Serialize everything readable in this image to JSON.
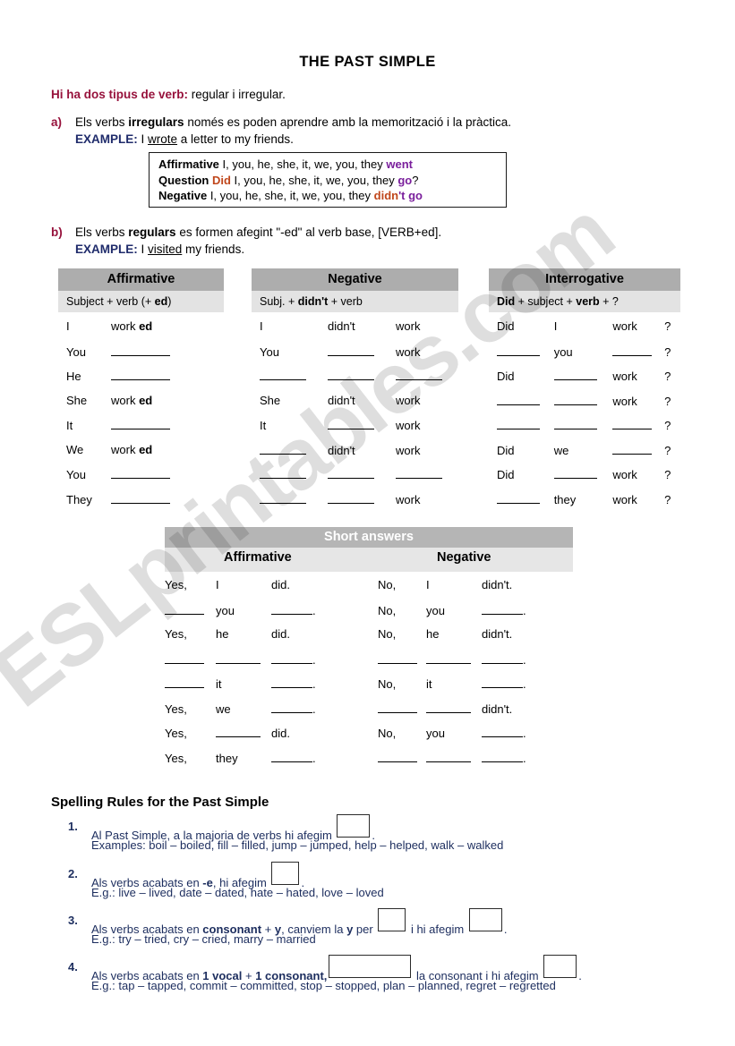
{
  "watermark": {
    "text": "ESLprintables.com"
  },
  "title": "THE PAST SIMPLE",
  "intro": {
    "lead_bold": "Hi ha dos tipus de verb:",
    "lead_rest": " regular i irregular.",
    "a_marker": "a)",
    "a_text_1": "Els verbs ",
    "a_text_bold": "irregulars",
    "a_text_2": " només es poden aprendre amb la memorització i la pràctica.",
    "a_example_label": "EXAMPLE:",
    "a_example_pre": " I ",
    "a_example_verb": "wrote",
    "a_example_post": " a letter to my friends.",
    "b_marker": "b)",
    "b_text_1": "Els verbs ",
    "b_text_bold": "regulars",
    "b_text_2": " es formen afegint \"-ed\" al verb base, [VERB+ed].",
    "b_example_label": "EXAMPLE:",
    "b_example_pre": " I ",
    "b_example_verb": "visited",
    "b_example_post": " my friends."
  },
  "irregular_box": {
    "rows": [
      {
        "label": "Affirmative",
        "pronouns": " I, you, he, she, it, we, you, they ",
        "aux": "",
        "verb": "went",
        "tail": ""
      },
      {
        "label": "Question",
        "aux": "Did",
        "pronouns": " I, you, he, she, it, we, you, they ",
        "verb": "go",
        "tail": "?"
      },
      {
        "label": "Negative",
        "pronouns": " I, you, he, she, it, we, you, they ",
        "aux": "didn",
        "verb": "'t go",
        "tail": ""
      }
    ]
  },
  "tables": {
    "affirmative": {
      "header": "Affirmative",
      "formula_parts": [
        "Subject + verb (+ ",
        "ed",
        ")"
      ],
      "rows": [
        {
          "subject": "I",
          "verb": "work",
          "suffix": "ed"
        },
        {
          "subject": "You",
          "verb": "",
          "suffix": ""
        },
        {
          "subject": "He",
          "verb": "",
          "suffix": ""
        },
        {
          "subject": "She",
          "verb": "work",
          "suffix": "ed"
        },
        {
          "subject": "It",
          "verb": "",
          "suffix": ""
        },
        {
          "subject": "We",
          "verb": "work",
          "suffix": "ed"
        },
        {
          "subject": "You",
          "verb": "",
          "suffix": ""
        },
        {
          "subject": "They",
          "verb": "",
          "suffix": ""
        }
      ]
    },
    "negative": {
      "header": "Negative",
      "formula_parts": [
        "Subj. + ",
        "didn't",
        " + verb"
      ],
      "rows": [
        {
          "subject": "I",
          "aux": "didn't",
          "verb": "work"
        },
        {
          "subject": "You",
          "aux": "",
          "verb": "work"
        },
        {
          "subject": "",
          "aux": "",
          "verb": ""
        },
        {
          "subject": "She",
          "aux": "didn't",
          "verb": "work"
        },
        {
          "subject": "It",
          "aux": "",
          "verb": "work"
        },
        {
          "subject": "",
          "aux": "didn't",
          "verb": "work"
        },
        {
          "subject": "",
          "aux": "",
          "verb": ""
        },
        {
          "subject": "",
          "aux": "",
          "verb": "work"
        }
      ]
    },
    "interrogative": {
      "header": "Interrogative",
      "formula_parts": [
        "Did",
        " + subject + ",
        "verb",
        " + ?"
      ],
      "question_mark": "?",
      "rows": [
        {
          "aux": "Did",
          "subject": "I",
          "verb": "work"
        },
        {
          "aux": "",
          "subject": "you",
          "verb": ""
        },
        {
          "aux": "Did",
          "subject": "",
          "verb": "work"
        },
        {
          "aux": "",
          "subject": "",
          "verb": "work"
        },
        {
          "aux": "",
          "subject": "",
          "verb": ""
        },
        {
          "aux": "Did",
          "subject": "we",
          "verb": ""
        },
        {
          "aux": "Did",
          "subject": "",
          "verb": "work"
        },
        {
          "aux": "",
          "subject": "they",
          "verb": "work"
        }
      ]
    }
  },
  "short_answers": {
    "title": "Short answers",
    "col_affirmative": "Affirmative",
    "col_negative": "Negative",
    "rows": [
      {
        "a_yes": "Yes,",
        "a_subj": "I",
        "a_aux": "did.",
        "n_no": "No,",
        "n_subj": "I",
        "n_aux": "didn't."
      },
      {
        "a_yes": "",
        "a_subj": "you",
        "a_aux": "",
        "n_no": "No,",
        "n_subj": "you",
        "n_aux": ""
      },
      {
        "a_yes": "Yes,",
        "a_subj": "he",
        "a_aux": "did.",
        "n_no": "No,",
        "n_subj": "he",
        "n_aux": "didn't."
      },
      {
        "a_yes": "",
        "a_subj": "",
        "a_aux": "",
        "n_no": "",
        "n_subj": "",
        "n_aux": ""
      },
      {
        "a_yes": "",
        "a_subj": "it",
        "a_aux": "",
        "n_no": "No,",
        "n_subj": "it",
        "n_aux": ""
      },
      {
        "a_yes": "Yes,",
        "a_subj": "we",
        "a_aux": "",
        "n_no": "",
        "n_subj": "",
        "n_aux": "didn't."
      },
      {
        "a_yes": "Yes,",
        "a_subj": "",
        "a_aux": "did.",
        "n_no": "No,",
        "n_subj": "you",
        "n_aux": ""
      },
      {
        "a_yes": "Yes,",
        "a_subj": "they",
        "a_aux": "",
        "n_no": "",
        "n_subj": "",
        "n_aux": ""
      }
    ]
  },
  "spelling": {
    "heading": "Spelling Rules for the Past Simple",
    "rules": [
      {
        "num": "1.",
        "pre": "Al Past Simple, a la majoria de verbs hi afegim ",
        "post": ".",
        "examples": "Examples: boil – boiled, fill – filled, jump – jumped, help – helped, walk – walked"
      },
      {
        "num": "2.",
        "pre_a": "Als verbs acabats en ",
        "bold_a": "-e",
        "pre_b": ", hi afegim ",
        "post": ".",
        "examples": "E.g.: live – lived, date – dated, hate – hated, love – loved"
      },
      {
        "num": "3.",
        "pre_a": "Als verbs acabats en ",
        "bold_a": "consonant",
        "mid_a": " + ",
        "bold_b": "y",
        "pre_b": ", canviem la ",
        "bold_c": "y",
        "pre_c": " per ",
        "mid_b": " i hi afegim ",
        "post": ".",
        "examples": "E.g.: try – tried, cry – cried, marry – married"
      },
      {
        "num": "4.",
        "pre_a": "Als verbs acabats en ",
        "bold_a": "1 vocal",
        "mid_a": " + ",
        "bold_b": "1 consonant,",
        "mid_b": " la consonant i hi afegim ",
        "post": ".",
        "examples": "E.g.: tap – tapped, commit – committed, stop – stopped, plan – planned, regret – regretted"
      }
    ]
  }
}
